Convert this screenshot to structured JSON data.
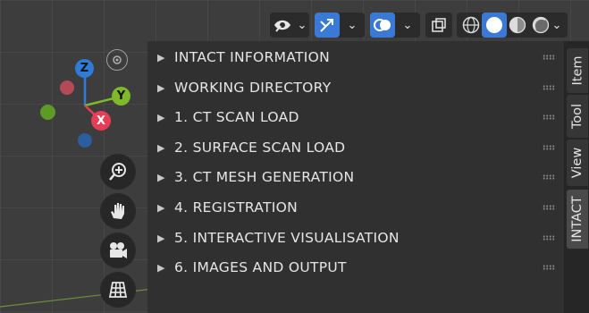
{
  "header": {
    "icons": [
      "eye-visibility-icon",
      "gizmo-arrows-icon",
      "overlay-circles-icon",
      "xray-toggle-icon",
      "wireframe-shading-icon",
      "solid-shading-icon",
      "material-shading-icon",
      "rendered-shading-icon"
    ]
  },
  "gizmo": {
    "x_label": "X",
    "y_label": "Y",
    "z_label": "Z",
    "colors": {
      "x": "#e83d56",
      "y": "#7fb82a",
      "z": "#2f7bd6",
      "x_neg": "#b54a57",
      "y_neg": "#5c9c26",
      "z_neg": "#2c5d9e"
    }
  },
  "nav_buttons": [
    "zoom-icon",
    "hand-pan-icon",
    "camera-icon",
    "grid-view-icon"
  ],
  "panel": {
    "rows": [
      {
        "label": "INTACT INFORMATION"
      },
      {
        "label": "WORKING DIRECTORY"
      },
      {
        "label": "1. CT SCAN LOAD"
      },
      {
        "label": "2. SURFACE SCAN LOAD"
      },
      {
        "label": "3. CT MESH GENERATION"
      },
      {
        "label": "4. REGISTRATION"
      },
      {
        "label": "5. INTERACTIVE VISUALISATION"
      },
      {
        "label": "6. IMAGES AND OUTPUT"
      }
    ]
  },
  "tabs": [
    {
      "label": "Item",
      "active": false
    },
    {
      "label": "Tool",
      "active": false
    },
    {
      "label": "View",
      "active": false
    },
    {
      "label": "INTACT",
      "active": true
    }
  ],
  "colors": {
    "accent": "#3a7ad6",
    "panel_bg": "#303030",
    "viewport_bg": "#3d3d3d"
  }
}
